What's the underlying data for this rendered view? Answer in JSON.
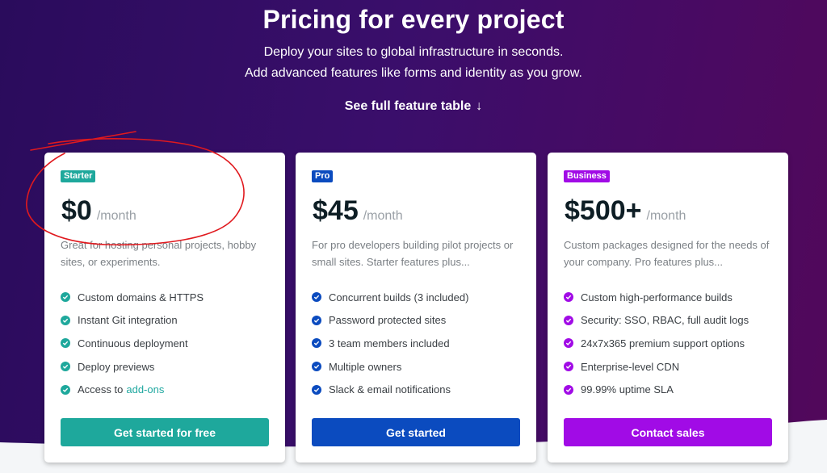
{
  "header": {
    "title": "Pricing for every project",
    "subtitle_line1": "Deploy your sites to global infrastructure in seconds.",
    "subtitle_line2": "Add advanced features like forms and identity as you grow.",
    "feature_table_link": "See full feature table",
    "feature_table_arrow": "↓"
  },
  "colors": {
    "background": "#3a0e6b",
    "starter_accent": "#1ea89c",
    "pro_accent": "#0b4bbf",
    "business_accent": "#a10be6",
    "annotation": "#e0191e"
  },
  "plans": [
    {
      "badge": "Starter",
      "price": "$0",
      "period": "/month",
      "description": "Great for hosting personal projects, hobby sites, or experiments.",
      "features": [
        "Custom domains & HTTPS",
        "Instant Git integration",
        "Continuous deployment",
        "Deploy previews",
        "Access to"
      ],
      "features_link": "add-ons",
      "cta": "Get started for free"
    },
    {
      "badge": "Pro",
      "price": "$45",
      "period": "/month",
      "description": "For pro developers building pilot projects or small sites. Starter features plus...",
      "features": [
        "Concurrent builds (3 included)",
        "Password protected sites",
        "3 team members included",
        "Multiple owners",
        "Slack & email notifications"
      ],
      "cta": "Get started"
    },
    {
      "badge": "Business",
      "price": "$500+",
      "period": "/month",
      "description": "Custom packages designed for the needs of your company. Pro features plus...",
      "features": [
        "Custom high-performance builds",
        "Security: SSO, RBAC, full audit logs",
        "24x7x365 premium support options",
        "Enterprise-level CDN",
        "99.99% uptime SLA"
      ],
      "cta": "Contact sales"
    }
  ]
}
